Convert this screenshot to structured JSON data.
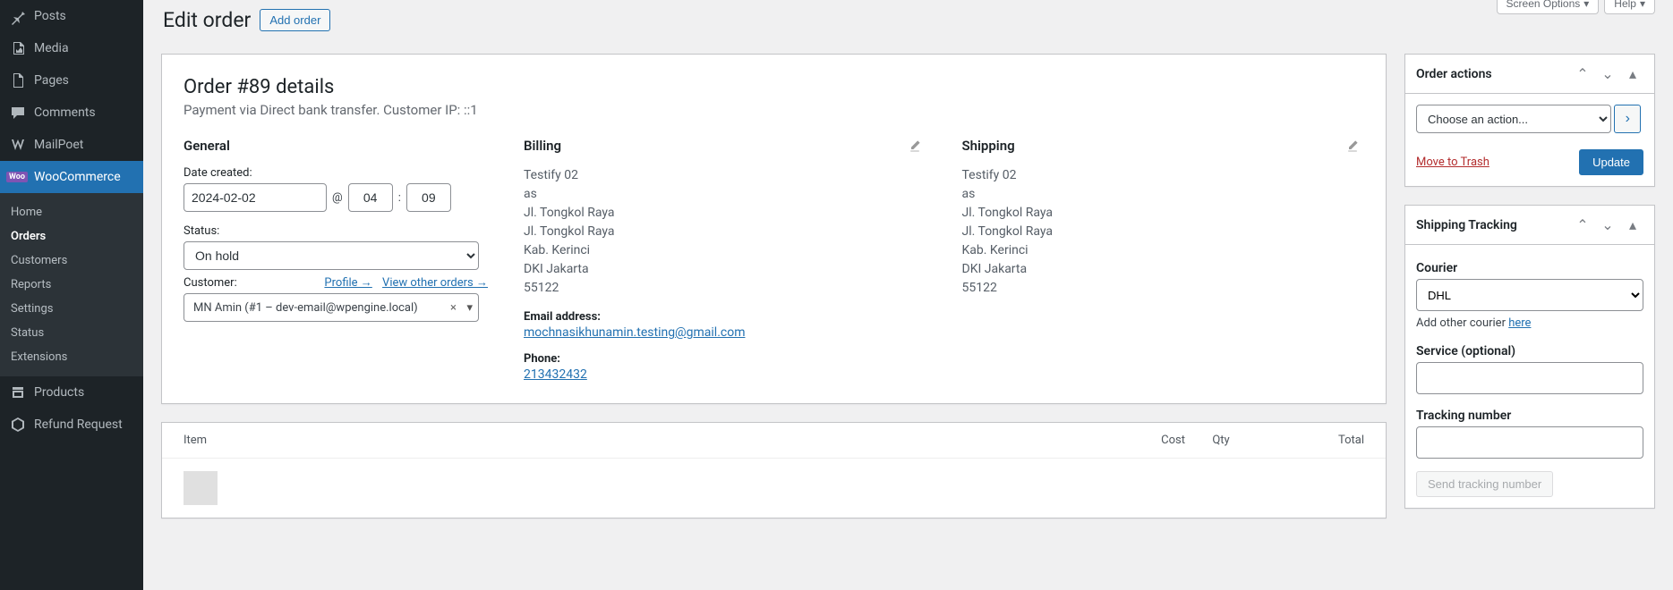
{
  "sidebar": {
    "items": [
      {
        "label": "Posts"
      },
      {
        "label": "Media"
      },
      {
        "label": "Pages"
      },
      {
        "label": "Comments"
      },
      {
        "label": "MailPoet"
      },
      {
        "label": "WooCommerce"
      },
      {
        "label": "Products"
      },
      {
        "label": "Refund Request"
      }
    ],
    "submenu": [
      {
        "label": "Home"
      },
      {
        "label": "Orders"
      },
      {
        "label": "Customers"
      },
      {
        "label": "Reports"
      },
      {
        "label": "Settings"
      },
      {
        "label": "Status"
      },
      {
        "label": "Extensions"
      }
    ]
  },
  "header": {
    "title": "Edit order",
    "add_button": "Add order",
    "screen_options": "Screen Options",
    "help": "Help"
  },
  "order": {
    "title": "Order #89 details",
    "subtitle": "Payment via Direct bank transfer. Customer IP: ::1",
    "general_h": "General",
    "billing_h": "Billing",
    "shipping_h": "Shipping",
    "date_label": "Date created:",
    "date_value": "2024-02-02",
    "hour": "04",
    "minute": "09",
    "at_symbol": "@",
    "colon_symbol": ":",
    "status_label": "Status:",
    "status_value": "On hold",
    "customer_label": "Customer:",
    "profile_link": "Profile →",
    "view_orders_link": "View other orders →",
    "customer_value": "MN Amin (#1 – dev-email@wpengine.local)",
    "billing": {
      "lines": [
        "Testify 02",
        "as",
        "Jl. Tongkol Raya",
        "Jl. Tongkol Raya",
        "Kab. Kerinci",
        "DKI Jakarta",
        "55122"
      ],
      "email_label": "Email address:",
      "email": "mochnasikhunamin.testing@gmail.com",
      "phone_label": "Phone:",
      "phone": "213432432"
    },
    "shipping": {
      "lines": [
        "Testify 02",
        "as",
        "Jl. Tongkol Raya",
        "Jl. Tongkol Raya",
        "Kab. Kerinci",
        "DKI Jakarta",
        "55122"
      ]
    }
  },
  "items_table": {
    "col_item": "Item",
    "col_cost": "Cost",
    "col_qty": "Qty",
    "col_total": "Total"
  },
  "actions_box": {
    "title": "Order actions",
    "placeholder": "Choose an action...",
    "trash": "Move to Trash",
    "update": "Update"
  },
  "tracking_box": {
    "title": "Shipping Tracking",
    "courier_label": "Courier",
    "courier_value": "DHL",
    "add_other_text": "Add other courier ",
    "add_other_link": "here",
    "service_label": "Service (optional)",
    "tracking_label": "Tracking number",
    "send_btn": "Send tracking number"
  }
}
